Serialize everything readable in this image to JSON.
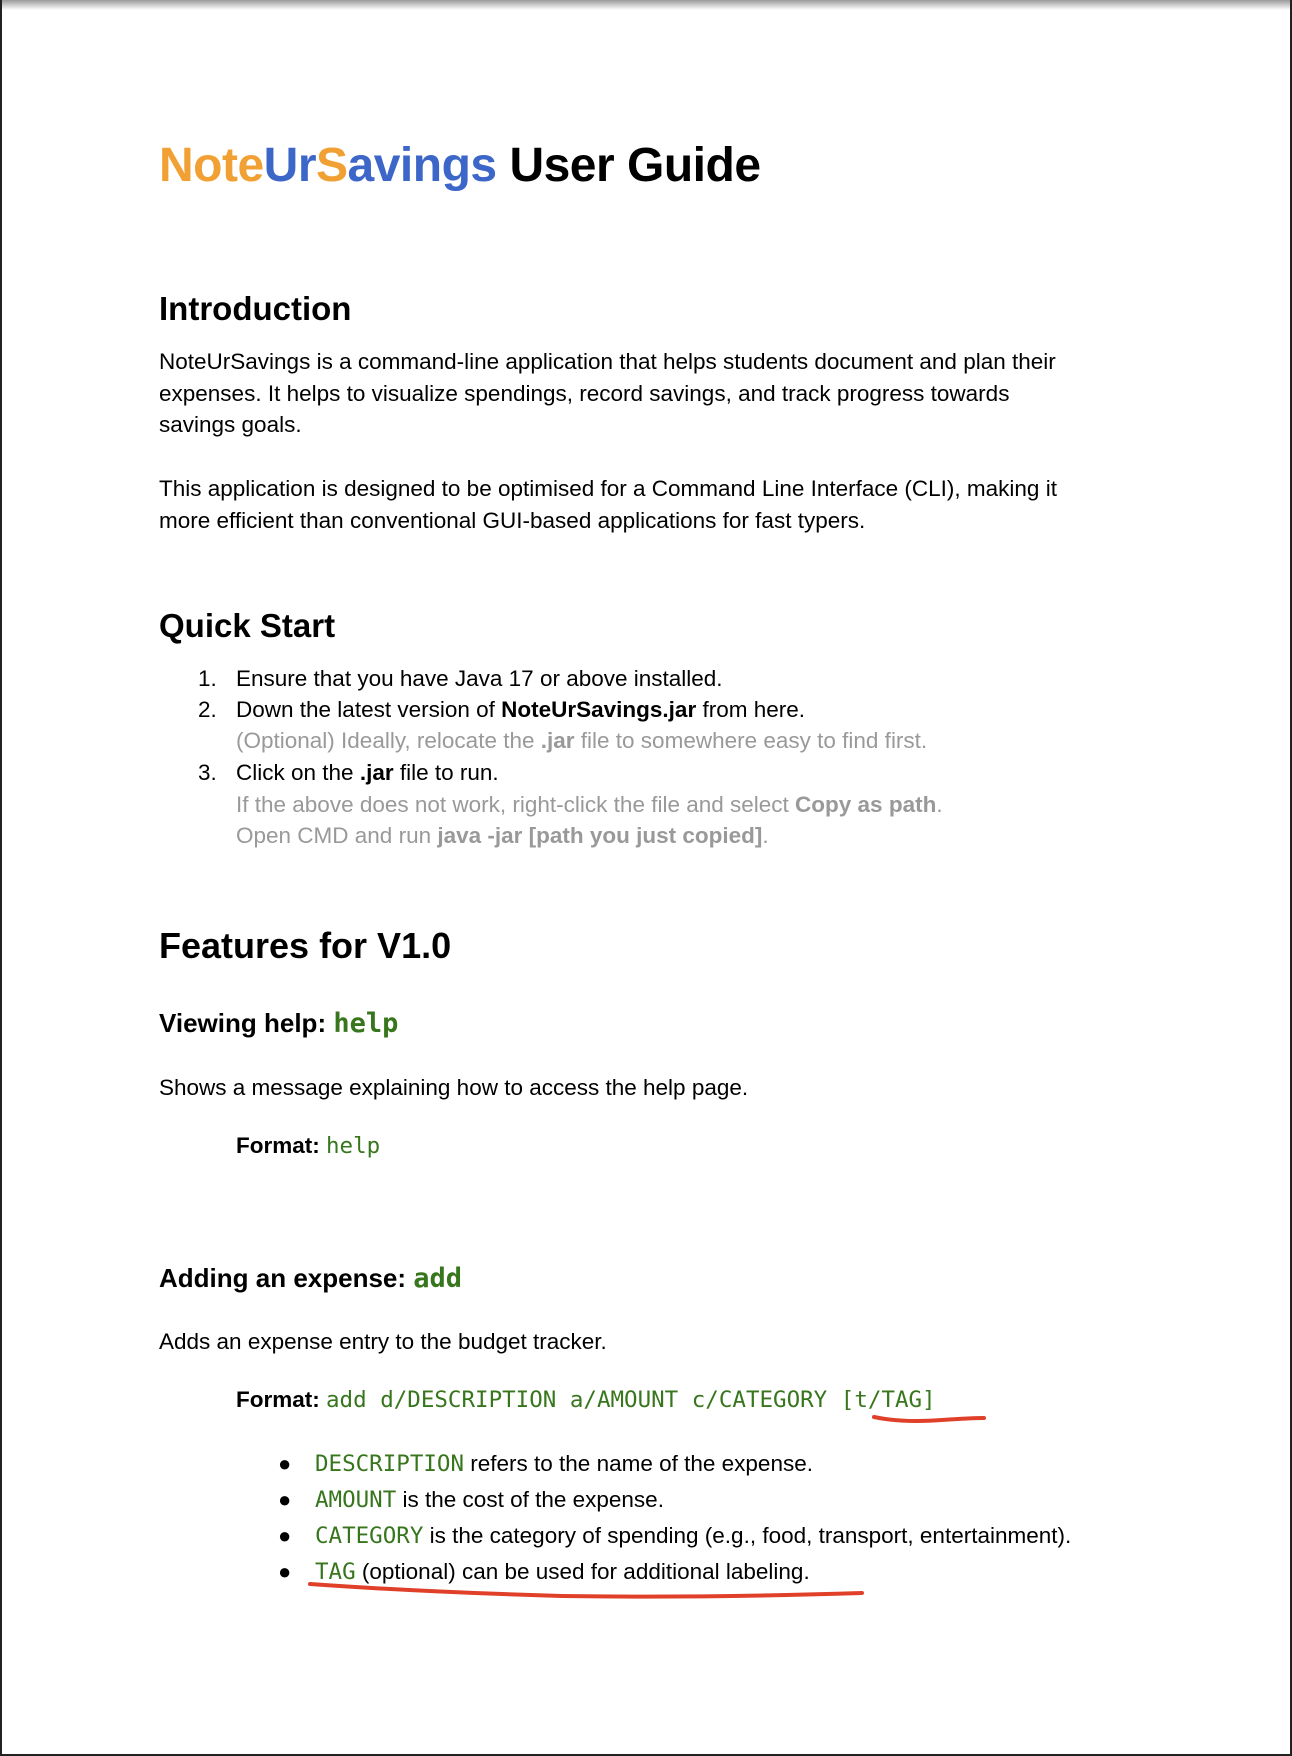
{
  "title": {
    "brand_parts": [
      "Note",
      "Ur",
      "S",
      "avings"
    ],
    "rest": "User Guide"
  },
  "introduction": {
    "heading": "Introduction",
    "para1_lines": [
      "NoteUrSavings is a command-line application that helps students document and plan their",
      "expenses. It helps to visualize spendings, record savings, and track progress towards",
      "savings goals."
    ],
    "para2_lines": [
      "This application is designed to be optimised for a Command Line Interface (CLI), making it",
      "more efficient than conventional GUI-based applications for fast typers."
    ]
  },
  "quick_start": {
    "heading": "Quick Start",
    "item1": {
      "num": "1.",
      "text": "Ensure that you have Java 17 or above installed."
    },
    "item2": {
      "num": "2.",
      "text_before": "Down the latest version of ",
      "bold": "NoteUrSavings.jar",
      "text_after": " from here.",
      "note_before": "(Optional) Ideally, relocate the ",
      "note_bold": ".jar",
      "note_after": " file to somewhere easy to find first."
    },
    "item3": {
      "num": "3.",
      "text_before": "Click on the ",
      "bold": ".jar",
      "text_after": " file to run.",
      "note1_before": "If the above does not work, right-click the file and select ",
      "note1_bold": "Copy as path",
      "note1_after": ".",
      "note2_before": "Open CMD and run ",
      "note2_bold": "java -jar [path you just copied]",
      "note2_after": "."
    }
  },
  "features": {
    "heading": "Features for V1.0",
    "help": {
      "heading_text": "Viewing help: ",
      "command": "help",
      "description": "Shows a message explaining how to access the help page.",
      "format_label": "Format:",
      "format_value": "help"
    },
    "add": {
      "heading_text": "Adding an expense: ",
      "command": "add",
      "description": "Adds an expense entry to the budget tracker.",
      "format_label": "Format:",
      "format_value": "add d/DESCRIPTION a/AMOUNT c/CATEGORY ",
      "format_optional": "[t/TAG]",
      "bullets": [
        {
          "code": "DESCRIPTION",
          "text": " refers to the name of the expense."
        },
        {
          "code": "AMOUNT",
          "text": " is the cost of the expense."
        },
        {
          "code": "CATEGORY",
          "text": " is the category of spending (e.g., food, transport, entertainment)."
        },
        {
          "code": "TAG",
          "text": " (optional) can be used for additional labeling."
        }
      ]
    }
  },
  "colors": {
    "brand_orange": "#f1a034",
    "brand_blue": "#3c66c8",
    "code_green": "#38761d",
    "note_grey": "#999999",
    "annotation_red": "#e0402a"
  }
}
